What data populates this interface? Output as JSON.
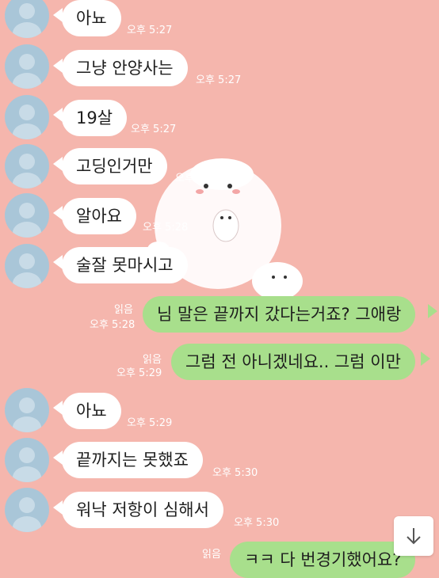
{
  "messages": [
    {
      "side": "left",
      "text": "아뇨",
      "time": "오후 5:27"
    },
    {
      "side": "left",
      "text": "그냥 안양사는",
      "time": "오후 5:27"
    },
    {
      "side": "left",
      "text": "19살",
      "time": "오후 5:27"
    },
    {
      "side": "left",
      "text": "고딩인거만",
      "time": "오후 5:27"
    },
    {
      "side": "left",
      "text": "알아요",
      "time": "오후 5:28"
    },
    {
      "side": "left",
      "text": "술잘 못마시고",
      "time": ""
    },
    {
      "side": "right",
      "text": "님 말은 끝까지 갔다는거죠? 그애랑",
      "read": "읽음",
      "time": "오후 5:28"
    },
    {
      "side": "right",
      "text": "그럼 전 아니겠네요.. 그럼 이만",
      "read": "읽음",
      "time": "오후 5:29"
    },
    {
      "side": "left",
      "text": "아뇨",
      "time": "오후 5:29"
    },
    {
      "side": "left",
      "text": "끝까지는 못했죠",
      "time": "오후 5:30"
    },
    {
      "side": "left",
      "text": "워낙 저항이 심해서",
      "time": "오후 5:30"
    },
    {
      "side": "right",
      "text": "ㅋㅋ 다 번경기했어요?",
      "read": "읽음",
      "time": ""
    }
  ],
  "colors": {
    "background": "#f5b6ad",
    "bubble_left": "#ffffff",
    "bubble_right": "#a8df8c",
    "avatar": "#a9c6d8"
  },
  "icons": {
    "scroll_down": "arrow-down-icon",
    "avatar": "default-profile-icon"
  }
}
